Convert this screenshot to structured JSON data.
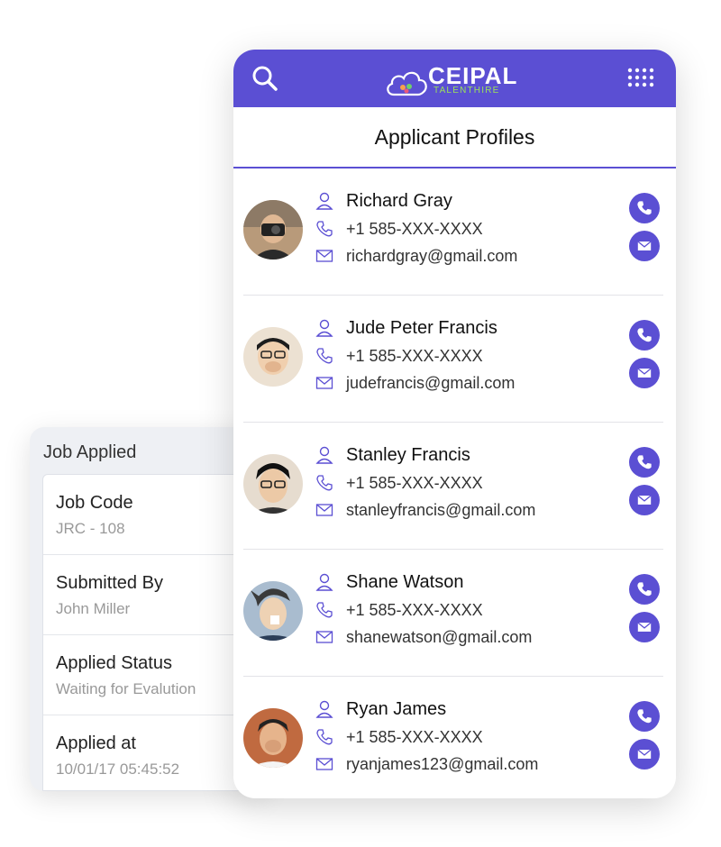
{
  "job_card": {
    "title": "Job Applied",
    "fields": [
      {
        "label": "Job Code",
        "value": "JRC - 108"
      },
      {
        "label": "Submitted By",
        "value": "John Miller"
      },
      {
        "label": "Applied Status",
        "value": "Waiting for Evalution"
      },
      {
        "label": "Applied at",
        "value": "10/01/17 05:45:52"
      }
    ]
  },
  "header": {
    "logo_name": "CEIPAL",
    "logo_sub": "TALENTHIRE",
    "accent_color": "#5b4fd3",
    "icons": [
      "search-icon",
      "grid-menu-icon"
    ]
  },
  "page_title": "Applicant Profiles",
  "profiles": [
    {
      "name": "Richard Gray",
      "phone": "+1 585-XXX-XXXX",
      "email": "richardgray@gmail.com",
      "avatar_color": "#b89a7a"
    },
    {
      "name": "Jude Peter Francis",
      "phone": "+1 585-XXX-XXXX",
      "email": "judefrancis@gmail.com",
      "avatar_color": "#e2cfb6"
    },
    {
      "name": "Stanley Francis",
      "phone": "+1 585-XXX-XXXX",
      "email": "stanleyfrancis@gmail.com",
      "avatar_color": "#d8c7b4"
    },
    {
      "name": "Shane Watson",
      "phone": "+1 585-XXX-XXXX",
      "email": "shanewatson@gmail.com",
      "avatar_color": "#9fb2c6"
    },
    {
      "name": "Ryan James",
      "phone": "+1 585-XXX-XXXX",
      "email": "ryanjames123@gmail.com",
      "avatar_color": "#c06a40"
    }
  ]
}
